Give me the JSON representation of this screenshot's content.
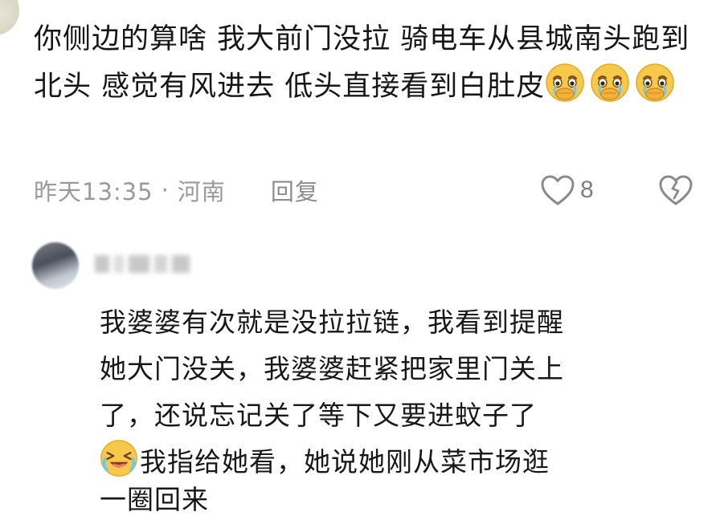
{
  "comment1": {
    "text": "你侧边的算啥 我大前门没拉 骑电车从县城南头跑到北头 感觉有风进去 低头直接看到白肚皮",
    "emojis": [
      "crying-face-emoji",
      "crying-face-emoji",
      "crying-face-emoji"
    ],
    "time": "昨天13:35",
    "separator": "·",
    "location": "河南",
    "reply_label": "回复",
    "like_count": "8"
  },
  "comment2": {
    "text_line1": "我婆婆有次就是没拉拉链，我看到提醒",
    "text_line2": "她大门没关，我婆婆赶紧把家里门关上",
    "text_line3": "了，还说忘记关了等下又要进蚊子了",
    "text_line4_after_emoji": "我指给她看，她说她刚从菜市场逛",
    "text_line5_partial": "一圈回来",
    "emoji": "crying-laughing-emoji"
  },
  "colors": {
    "text": "#161616",
    "meta": "#9a9a9a",
    "emoji_yellow": "#f7c94b"
  }
}
